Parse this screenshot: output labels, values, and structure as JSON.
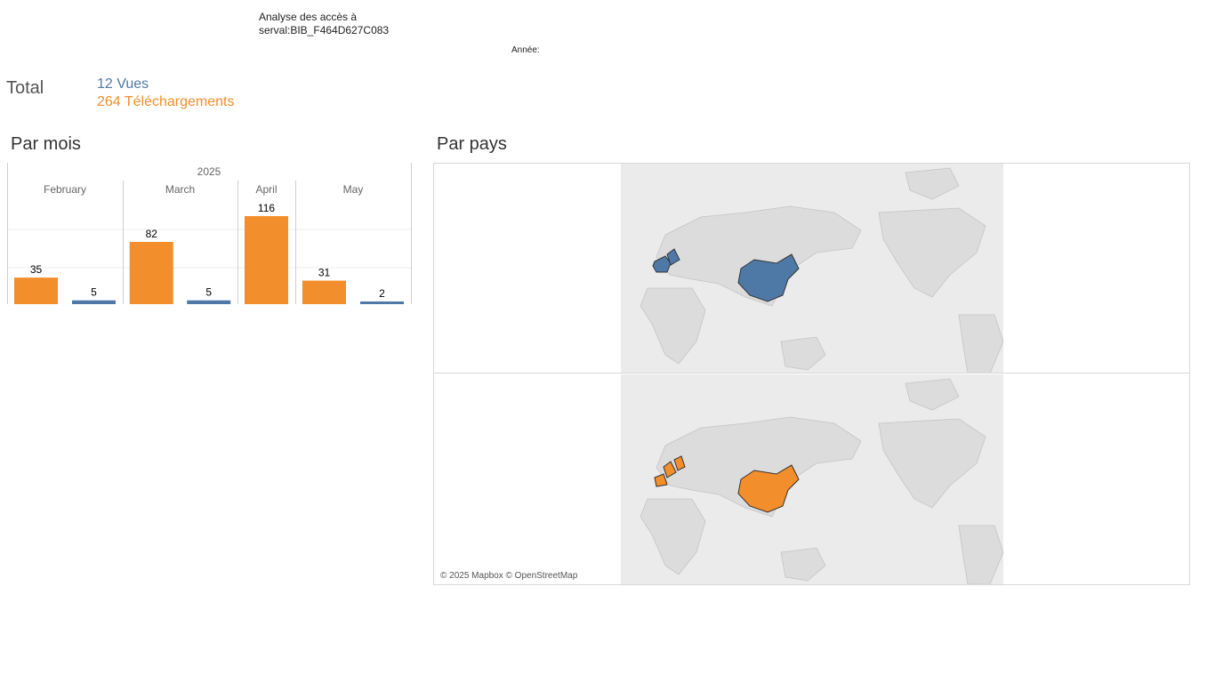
{
  "header": {
    "title_line1": "Analyse des accès à",
    "title_line2": "serval:BIB_F464D627C083",
    "year_filter_label": "Année:"
  },
  "totals": {
    "label": "Total",
    "views": "12 Vues",
    "downloads": "264 Téléchargements"
  },
  "sections": {
    "by_month": "Par mois",
    "by_country": "Par pays"
  },
  "colors": {
    "views": "#4e79a7",
    "downloads": "#f28e2b",
    "map_land": "#dcdcdc"
  },
  "chart_data": {
    "type": "bar",
    "year": "2025",
    "categories": [
      "February",
      "March",
      "April",
      "May"
    ],
    "series": [
      {
        "name": "Téléchargements",
        "color": "#f28e2b",
        "values": [
          35,
          82,
          116,
          31
        ]
      },
      {
        "name": "Vues",
        "color": "#4e79a7",
        "values": [
          5,
          5,
          null,
          2
        ]
      }
    ],
    "ylim": [
      0,
      116
    ],
    "grid": true
  },
  "map": {
    "credit": "© 2025 Mapbox © OpenStreetMap",
    "views_countries": [
      "France",
      "Switzerland",
      "China"
    ],
    "downloads_countries": [
      "France",
      "Spain",
      "Switzerland",
      "China"
    ]
  }
}
